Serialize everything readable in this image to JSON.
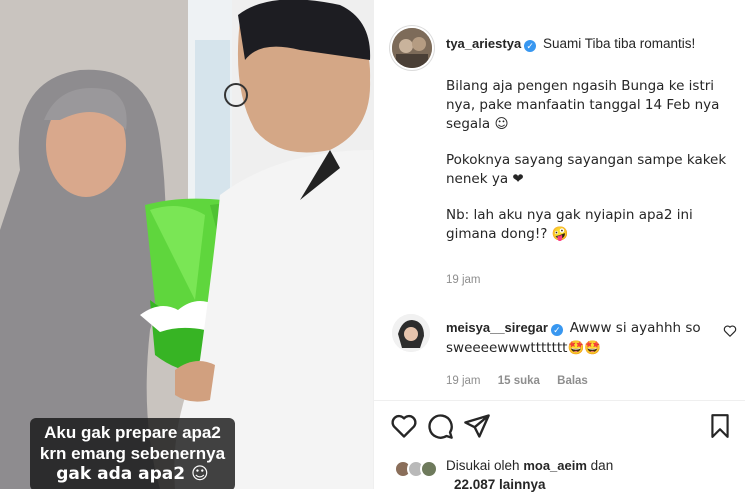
{
  "video": {
    "caption_lines": [
      "Aku gak prepare apa2",
      "krn emang sebenernya",
      "gak ada apa2 ☺"
    ]
  },
  "post": {
    "username": "tya_ariestya",
    "headline": "Suami Tiba tiba romantis!",
    "paragraphs": [
      "Bilang aja pengen ngasih Bunga ke istri nya, pake manfaatin tanggal 14 Feb nya segala ☺",
      "Pokoknya sayang sayangan sampe kakek nenek ya ❤",
      "Nb: lah aku nya gak nyiapin apa2 ini gimana dong!? 🤪"
    ],
    "time": "19 jam"
  },
  "comment": {
    "username": "meisya__siregar",
    "text": "Awww si ayahhh so sweeeewwwttttttt🤩🤩",
    "time": "19 jam",
    "likes": "15 suka",
    "reply": "Balas"
  },
  "likes": {
    "prefix": "Disukai oleh",
    "user": "moa_aeim",
    "suffix": "dan",
    "line2": "22.087 lainnya"
  },
  "icons": [
    "heart-icon",
    "comment-icon",
    "share-icon",
    "save-icon",
    "verified-badge-icon"
  ],
  "colors": {
    "verified": "#3897f0",
    "muted": "#8e8e8e",
    "text": "#262626",
    "heart": "#ed4956"
  }
}
